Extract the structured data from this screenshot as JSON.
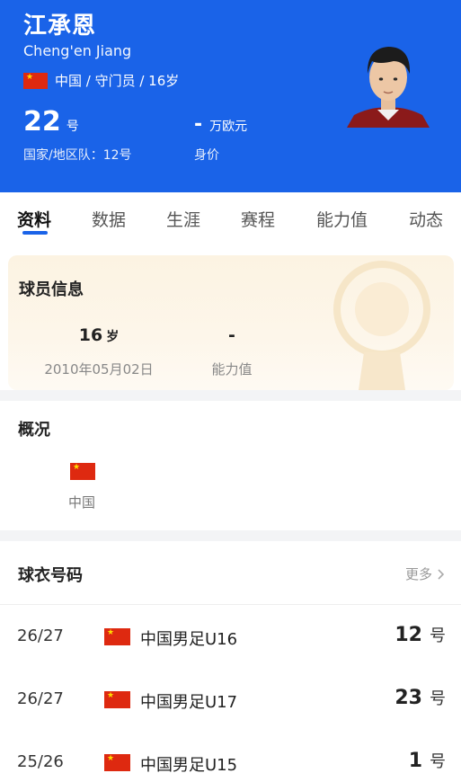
{
  "player": {
    "name_cn": "江承恩",
    "name_en": "Cheng'en Jiang",
    "meta": "中国 / 守门员 / 16岁",
    "shirt_number": "22",
    "shirt_unit": "号",
    "shirt_label": "国家/地区队：12号",
    "market_value": "-",
    "market_value_unit": "万欧元",
    "market_value_label": "身价"
  },
  "tabs": [
    "资料",
    "数据",
    "生涯",
    "赛程",
    "能力值",
    "动态"
  ],
  "active_tab": "资料",
  "info_card": {
    "title": "球员信息",
    "age_value": "16",
    "age_unit": "岁",
    "birthdate": "2010年05月02日",
    "ability_value": "-",
    "ability_label": "能力值"
  },
  "overview": {
    "title": "概况",
    "country": "中国"
  },
  "jersey": {
    "title": "球衣号码",
    "more_label": "更多",
    "rows": [
      {
        "season": "26/27",
        "team": "中国男足U16",
        "number": "12",
        "unit": "号"
      },
      {
        "season": "26/27",
        "team": "中国男足U17",
        "number": "23",
        "unit": "号"
      },
      {
        "season": "25/26",
        "team": "中国男足U15",
        "number": "1",
        "unit": "号"
      }
    ]
  },
  "colors": {
    "header_blue": "#1a63e8",
    "flag_red": "#de2910",
    "flag_star": "#ffde00"
  },
  "icons": [
    "china-flag-icon",
    "chevron-right-icon",
    "player-avatar"
  ]
}
